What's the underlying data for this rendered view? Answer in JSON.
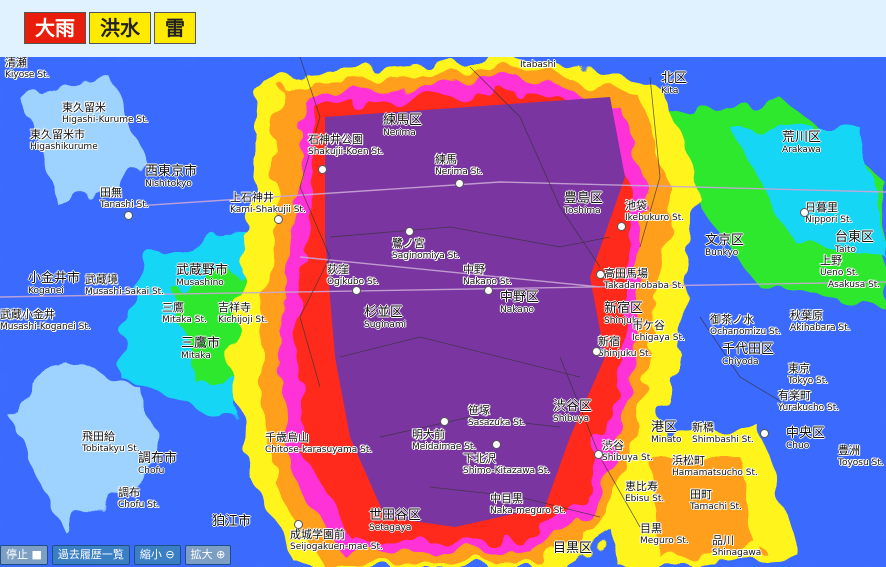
{
  "tabs": [
    "大雨",
    "洪水",
    "雷"
  ],
  "controls": {
    "stop": "停止",
    "history": "過去履歴一覧",
    "zoom_out": "縮小",
    "zoom_in": "拡大"
  },
  "wards": [
    {
      "jp": "練馬区",
      "en": "Nerima"
    },
    {
      "jp": "杉並区",
      "en": "Suginami"
    },
    {
      "jp": "中野区",
      "en": "Nakano"
    },
    {
      "jp": "豊島区",
      "en": "Toshima"
    },
    {
      "jp": "北区",
      "en": "Kita"
    },
    {
      "jp": "荒川区",
      "en": "Arakawa"
    },
    {
      "jp": "文京区",
      "en": "Bunkyo"
    },
    {
      "jp": "台東区",
      "en": "Taito"
    },
    {
      "jp": "新宿区",
      "en": "Shinjuku"
    },
    {
      "jp": "千代田区",
      "en": "Chiyoda"
    },
    {
      "jp": "中央区",
      "en": "Chuo"
    },
    {
      "jp": "渋谷区",
      "en": "Shibuya"
    },
    {
      "jp": "港区",
      "en": "Minato"
    },
    {
      "jp": "世田谷区",
      "en": "Setagaya"
    },
    {
      "jp": "目黒区",
      "en": ""
    },
    {
      "jp": "調布市",
      "en": "Chofu"
    },
    {
      "jp": "三鷹市",
      "en": "Mitaka"
    },
    {
      "jp": "武蔵野市",
      "en": "Musashino"
    },
    {
      "jp": "西東京市",
      "en": "Nishitokyo"
    },
    {
      "jp": "小金井市",
      "en": "Koganei"
    },
    {
      "jp": "狛江市",
      "en": ""
    }
  ],
  "stations": [
    {
      "jp": "清瀬",
      "en": "Kiyose St."
    },
    {
      "jp": "東久留米",
      "en": "Higashi-Kurume St."
    },
    {
      "jp": "東久留米市",
      "en": "Higashikurume"
    },
    {
      "jp": "田無",
      "en": "Tanashi St."
    },
    {
      "jp": "石神井公園",
      "en": "Shakujii-Koen St."
    },
    {
      "jp": "上石神井",
      "en": "Kami-Shakujii St."
    },
    {
      "jp": "練馬",
      "en": "Nerima St."
    },
    {
      "jp": "鷺ノ宮",
      "en": "Saginomiya St."
    },
    {
      "jp": "荻窪",
      "en": "Ogikubo St."
    },
    {
      "jp": "中野",
      "en": "Nakano St."
    },
    {
      "jp": "池袋",
      "en": "Ikebukuro St."
    },
    {
      "jp": "高田馬場",
      "en": "Takadanobaba St."
    },
    {
      "jp": "日暮里",
      "en": "Nippori St."
    },
    {
      "jp": "上野",
      "en": "Ueno St."
    },
    {
      "jp": "武蔵境",
      "en": "Musashi-Sakai St."
    },
    {
      "jp": "三鷹",
      "en": "Mitaka St."
    },
    {
      "jp": "吉祥寺",
      "en": "Kichijoji St."
    },
    {
      "jp": "武蔵小金井",
      "en": "Musashi-Koganei St."
    },
    {
      "jp": "新宿",
      "en": "Shinjuku St."
    },
    {
      "jp": "市ケ谷",
      "en": "Ichigaya St."
    },
    {
      "jp": "御茶ノ水",
      "en": "Ochanomizu St."
    },
    {
      "jp": "秋葉原",
      "en": "Akihabara St."
    },
    {
      "jp": "東京",
      "en": "Tokyo St."
    },
    {
      "jp": "有楽町",
      "en": "Yurakucho St."
    },
    {
      "jp": "笹塚",
      "en": "Sasazuka St."
    },
    {
      "jp": "明大前",
      "en": "Meidaimae St."
    },
    {
      "jp": "下北沢",
      "en": "Shimo-Kitazawa St."
    },
    {
      "jp": "千歳烏山",
      "en": "Chitose-karasuyama St."
    },
    {
      "jp": "飛田給",
      "en": "Tobitakyu St."
    },
    {
      "jp": "調布",
      "en": "Chofu St."
    },
    {
      "jp": "渋谷",
      "en": "Shibuya St."
    },
    {
      "jp": "恵比寿",
      "en": "Ebisu St."
    },
    {
      "jp": "中目黒",
      "en": "Naka-meguro St."
    },
    {
      "jp": "目黒",
      "en": "Meguro St."
    },
    {
      "jp": "浜松町",
      "en": "Hamamatsucho St."
    },
    {
      "jp": "新橋",
      "en": "Shimbashi St."
    },
    {
      "jp": "田町",
      "en": "Tamachi St."
    },
    {
      "jp": "品川",
      "en": "Shinagawa"
    },
    {
      "jp": "成城学園前",
      "en": "Seijogakuen-mae St."
    },
    {
      "jp": "豊洲",
      "en": "Toyosu St."
    },
    {
      "jp": "浅草",
      "en": "Asakusa St."
    },
    {
      "jp": "板橋",
      "en": "Itabashi"
    }
  ],
  "colors": {
    "purple": "#7a35a0",
    "red": "#ff2a1a",
    "magenta": "#ff30d8",
    "orange": "#ff9f1a",
    "yellow": "#fff51a",
    "green": "#2ee82e",
    "cyan": "#16d6f5",
    "blue": "#3b6bff",
    "lightblue": "#9ed2ff"
  }
}
